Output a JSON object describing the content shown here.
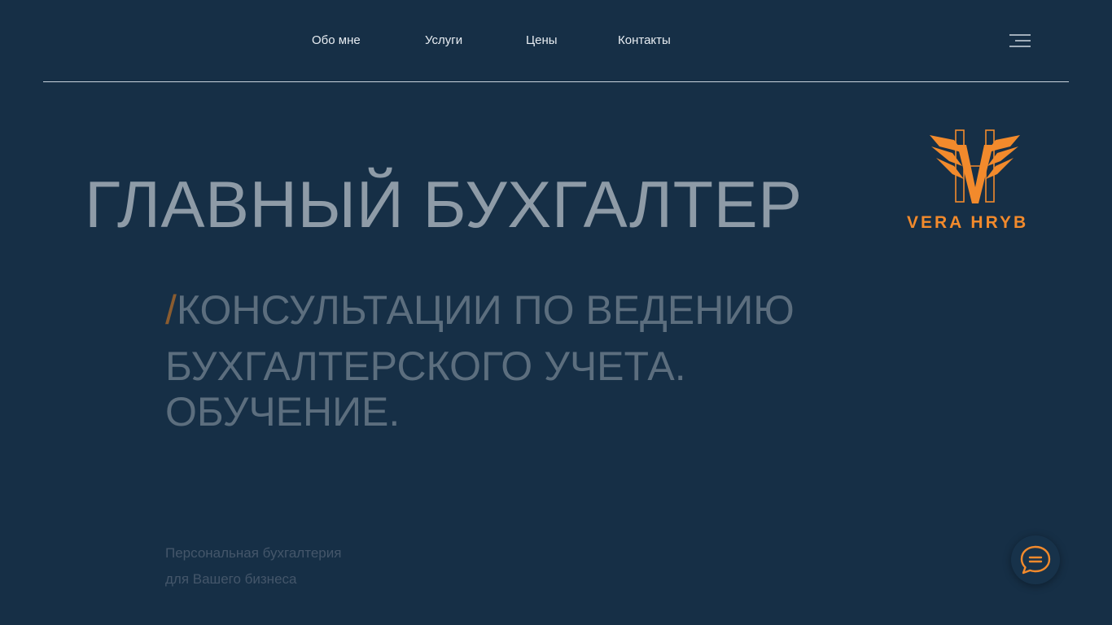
{
  "nav": {
    "items": [
      "Обо мне",
      "Услуги",
      "Цены",
      "Контакты"
    ],
    "menu_icon": "hamburger-menu-icon"
  },
  "logo": {
    "text": "VERA HRYB",
    "icon": "vh-monogram-logo",
    "color": "#f28a2c"
  },
  "hero": {
    "title": "ГЛАВНЫЙ БУХГАЛТЕР",
    "slash": "/",
    "subtitle_lines": [
      "КОНСУЛЬТАЦИИ ПО ВЕДЕНИЮ",
      "БУХГАЛТЕРСКОГО УЧЕТА.",
      "ОБУЧЕНИЕ."
    ],
    "tagline_lines": [
      "Персональная бухгалтерия",
      "для Вашего бизнеса"
    ]
  },
  "chat": {
    "icon": "chat-bubble-icon"
  },
  "colors": {
    "background": "#162f46",
    "accent": "#f28a2c"
  }
}
